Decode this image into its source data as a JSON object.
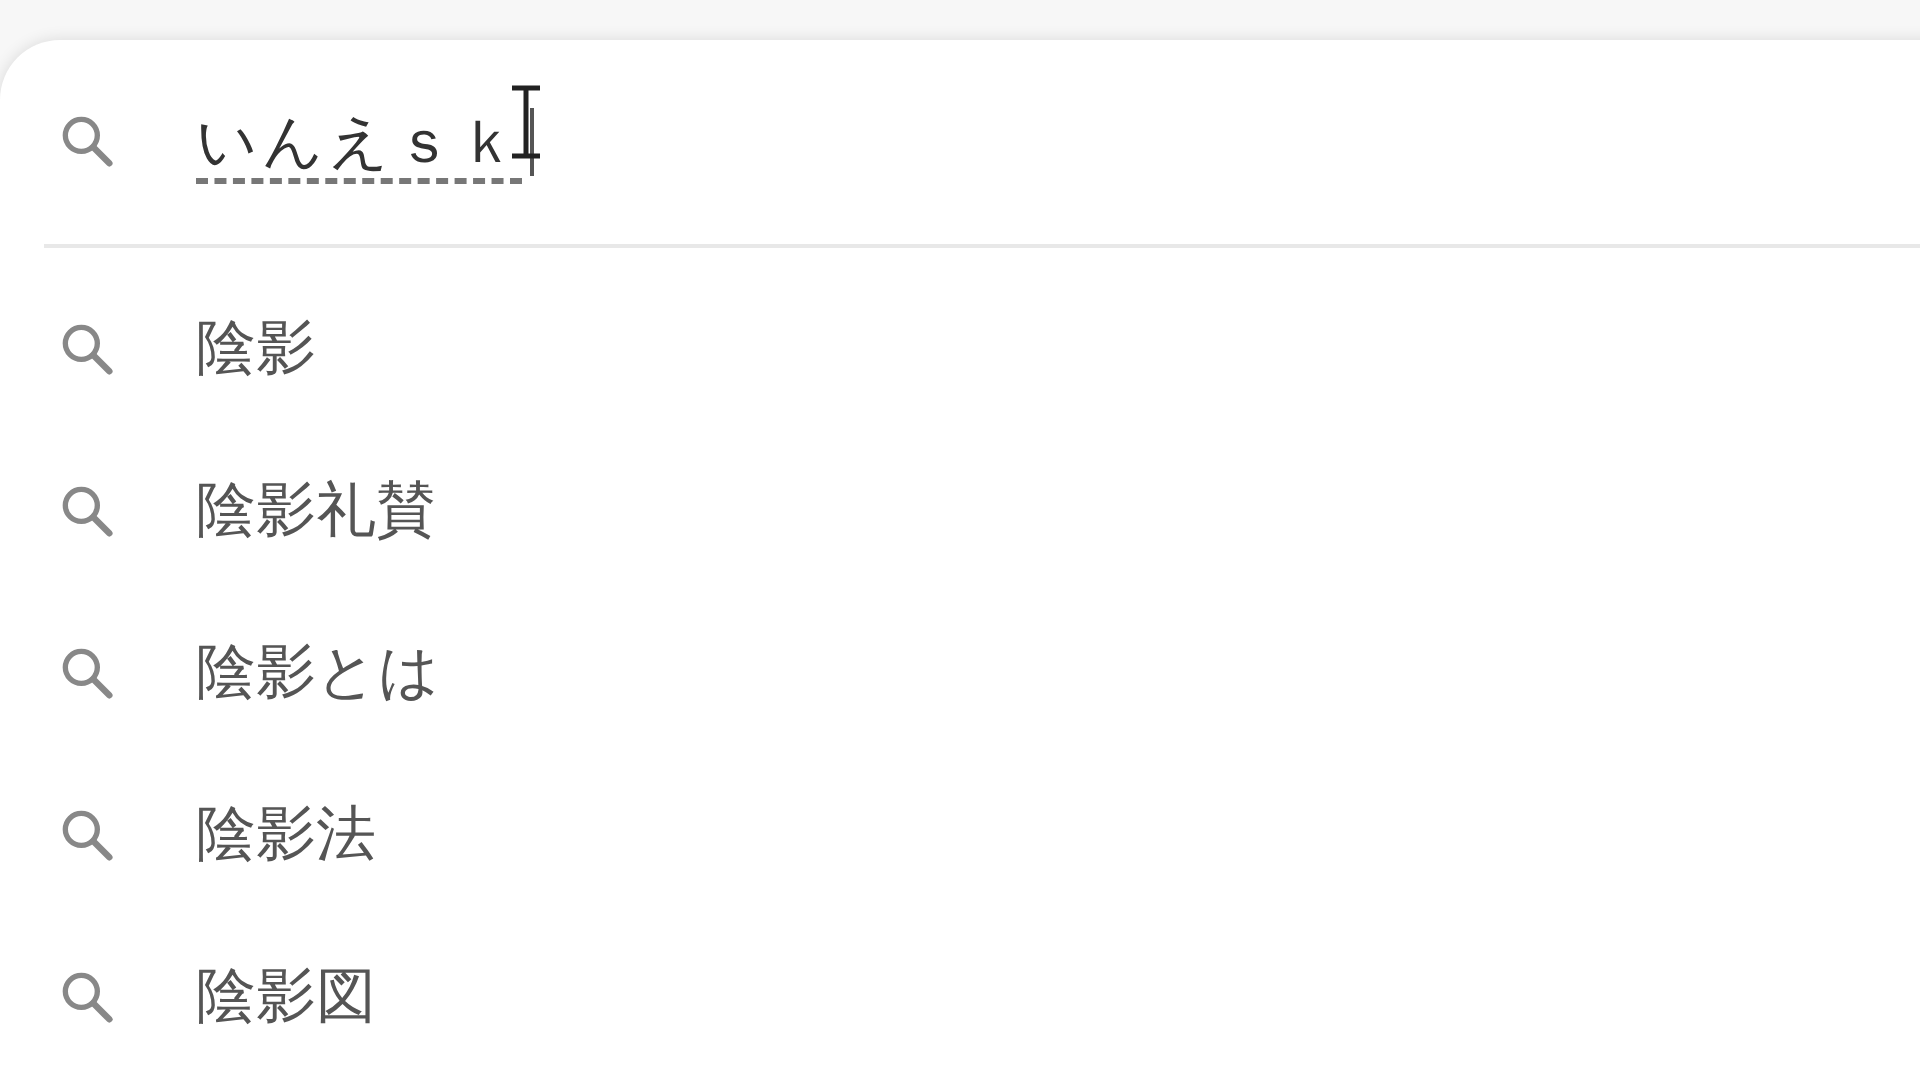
{
  "search": {
    "value": "いんえｓｋ"
  },
  "suggestions": [
    {
      "text": "陰影"
    },
    {
      "text": "陰影礼賛"
    },
    {
      "text": "陰影とは"
    },
    {
      "text": "陰影法"
    },
    {
      "text": "陰影図"
    }
  ]
}
